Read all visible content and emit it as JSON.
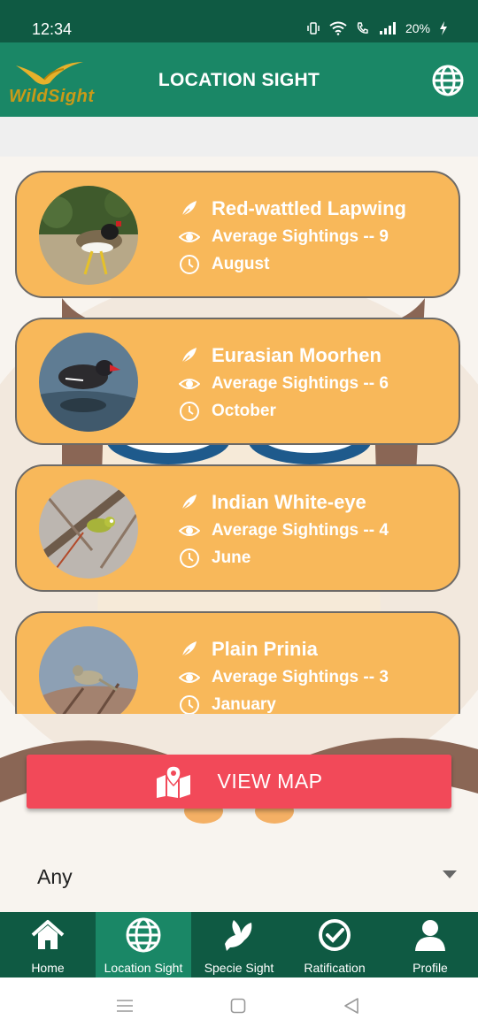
{
  "status": {
    "time": "12:34",
    "battery": "20%"
  },
  "app": {
    "logo_text": "WildSight",
    "title": "LOCATION SIGHT"
  },
  "birds": [
    {
      "name": "Red-wattled Lapwing",
      "sightings": "Average Sightings -- 9",
      "month": "August"
    },
    {
      "name": "Eurasian Moorhen",
      "sightings": "Average Sightings -- 6",
      "month": "October"
    },
    {
      "name": "Indian White-eye",
      "sightings": "Average Sightings -- 4",
      "month": "June"
    },
    {
      "name": "Plain Prinia",
      "sightings": "Average Sightings -- 3",
      "month": "January"
    }
  ],
  "view_map": {
    "label": "VIEW MAP"
  },
  "filter": {
    "selected": "Any"
  },
  "nav": [
    {
      "label": "Home",
      "icon": "home-icon"
    },
    {
      "label": "Location Sight",
      "icon": "globe-icon"
    },
    {
      "label": "Specie Sight",
      "icon": "dove-icon"
    },
    {
      "label": "Ratification",
      "icon": "check-circle-icon"
    },
    {
      "label": "Profile",
      "icon": "user-icon"
    }
  ],
  "colors": {
    "primary_dark": "#0f5a43",
    "primary": "#1a8766",
    "card": "#f8b85a",
    "accent": "#f24959"
  }
}
